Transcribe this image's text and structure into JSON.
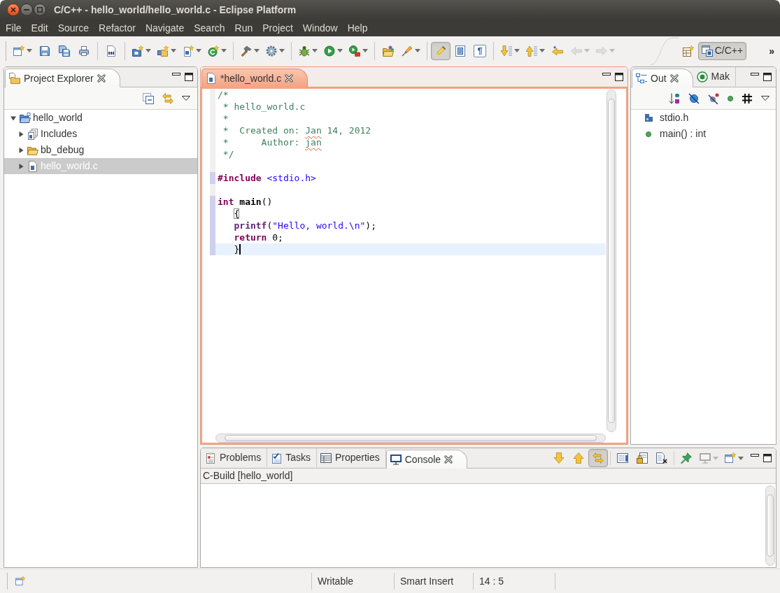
{
  "window": {
    "title": "C/C++ - hello_world/hello_world.c - Eclipse Platform"
  },
  "menu": [
    "File",
    "Edit",
    "Source",
    "Refactor",
    "Navigate",
    "Search",
    "Run",
    "Project",
    "Window",
    "Help"
  ],
  "toolbar": {
    "groups": [
      [
        {
          "dropdown": true,
          "pressed": false,
          "disabled": false
        },
        {
          "dropdown": false,
          "pressed": false,
          "disabled": false
        },
        {
          "dropdown": false,
          "pressed": false,
          "disabled": false
        },
        {
          "dropdown": false,
          "pressed": false,
          "disabled": false
        }
      ],
      [
        {
          "dropdown": false,
          "pressed": false,
          "disabled": false
        }
      ],
      [
        {
          "dropdown": true,
          "pressed": false,
          "disabled": false
        },
        {
          "dropdown": true,
          "pressed": false,
          "disabled": false
        },
        {
          "dropdown": true,
          "pressed": false,
          "disabled": false
        },
        {
          "dropdown": true,
          "pressed": false,
          "disabled": false
        }
      ],
      [
        {
          "dropdown": true,
          "pressed": false,
          "disabled": false
        },
        {
          "dropdown": true,
          "pressed": false,
          "disabled": false
        }
      ],
      [
        {
          "dropdown": true,
          "pressed": false,
          "disabled": false
        },
        {
          "dropdown": true,
          "pressed": false,
          "disabled": false
        },
        {
          "dropdown": true,
          "pressed": false,
          "disabled": false
        }
      ],
      [
        {
          "dropdown": false,
          "pressed": false,
          "disabled": false
        },
        {
          "dropdown": true,
          "pressed": false,
          "disabled": false
        }
      ],
      [
        {
          "dropdown": false,
          "pressed": true,
          "disabled": false
        },
        {
          "dropdown": false,
          "pressed": false,
          "disabled": false
        },
        {
          "glyph": "¶",
          "dropdown": false,
          "pressed": false,
          "disabled": false
        }
      ],
      [
        {
          "dropdown": true,
          "pressed": false,
          "disabled": false
        },
        {
          "dropdown": true,
          "pressed": false,
          "disabled": false
        },
        {
          "dropdown": false,
          "pressed": false,
          "disabled": false
        },
        {
          "dropdown": true,
          "pressed": false,
          "disabled": true
        },
        {
          "dropdown": true,
          "pressed": false,
          "disabled": true
        }
      ]
    ]
  },
  "perspectives": {
    "items": [
      {
        "label": "C/C++",
        "selected": true
      }
    ],
    "overflow": "»"
  },
  "project_explorer": {
    "active": false,
    "tabs": [
      {
        "label": "Project Explorer",
        "selected": true
      }
    ],
    "tree": [
      {
        "kind": "project",
        "label": "hello_world",
        "expanded": true,
        "selected": false,
        "children": [
          {
            "kind": "includes",
            "label": "Includes",
            "expanded": false,
            "selected": false
          },
          {
            "kind": "folder",
            "label": "bb_debug",
            "expanded": false,
            "selected": false
          },
          {
            "kind": "source",
            "label": "hello_world.c",
            "expanded": false,
            "selected": true
          }
        ]
      }
    ]
  },
  "editor": {
    "active": true,
    "tabs": [
      {
        "label": "*hello_world.c",
        "selected": true
      }
    ],
    "lines": [
      {
        "changed": false,
        "current": false,
        "tokens": [
          {
            "kind": "comment",
            "text": "/*"
          }
        ]
      },
      {
        "changed": false,
        "current": false,
        "tokens": [
          {
            "kind": "comment",
            "text": " * hello_world.c"
          }
        ]
      },
      {
        "changed": false,
        "current": false,
        "tokens": [
          {
            "kind": "comment",
            "text": " *"
          }
        ]
      },
      {
        "changed": false,
        "current": false,
        "tokens": [
          {
            "kind": "comment",
            "text": " *  Created on: "
          },
          {
            "kind": "misspelled",
            "text": "Jan"
          },
          {
            "kind": "comment",
            "text": " 14, 2012"
          }
        ]
      },
      {
        "changed": false,
        "current": false,
        "tokens": [
          {
            "kind": "comment",
            "text": " *      Author: "
          },
          {
            "kind": "misspelled",
            "text": "jan"
          }
        ]
      },
      {
        "changed": false,
        "current": false,
        "tokens": [
          {
            "kind": "comment",
            "text": " */"
          }
        ]
      },
      {
        "changed": false,
        "current": false
      },
      {
        "changed": true,
        "current": false,
        "tokens": [
          {
            "kind": "preprocessor",
            "text": "#include"
          },
          {
            "kind": "include",
            "text": " <stdio.h>"
          }
        ]
      },
      {
        "changed": false,
        "current": false
      },
      {
        "changed": true,
        "current": false,
        "tokens": [
          {
            "kind": "keyword",
            "text": "int"
          },
          {
            "kind": "bold",
            "text": " main"
          },
          {
            "kind": "plain",
            "text": "()"
          }
        ]
      },
      {
        "changed": true,
        "current": false,
        "tokens": [
          {
            "kind": "bracket-match",
            "text": "   {"
          }
        ]
      },
      {
        "changed": true,
        "current": false,
        "tokens": [
          {
            "kind": "function",
            "text": "   printf"
          },
          {
            "kind": "plain",
            "text": "("
          },
          {
            "kind": "string",
            "text": "\"Hello, world.\\n\""
          },
          {
            "kind": "plain",
            "text": ");"
          }
        ]
      },
      {
        "changed": true,
        "current": false,
        "tokens": [
          {
            "kind": "keyword",
            "text": "   return"
          },
          {
            "kind": "plain",
            "text": " 0;"
          }
        ]
      },
      {
        "changed": true,
        "current": true,
        "tokens": [
          {
            "kind": "plain",
            "text": "   }"
          }
        ]
      }
    ]
  },
  "outline": {
    "active": false,
    "tabs": [
      {
        "label": "Out",
        "selected": true
      },
      {
        "label": "Mak",
        "selected": false
      }
    ],
    "items": [
      {
        "kind": "include",
        "label": "stdio.h"
      },
      {
        "kind": "function",
        "label": "main() : int"
      }
    ]
  },
  "console": {
    "active": false,
    "tabs": [
      {
        "label": "Problems",
        "selected": false
      },
      {
        "label": "Tasks",
        "selected": false
      },
      {
        "label": "Properties",
        "selected": false
      },
      {
        "label": "Console",
        "selected": true
      }
    ],
    "toolbar": {
      "groups": [
        [
          {
            "dropdown": false,
            "pressed": false,
            "disabled": false
          },
          {
            "dropdown": false,
            "pressed": false,
            "disabled": false
          },
          {
            "dropdown": false,
            "pressed": true,
            "disabled": false
          }
        ],
        [
          {
            "dropdown": false,
            "pressed": false,
            "disabled": false
          },
          {
            "dropdown": false,
            "pressed": false,
            "disabled": false
          },
          {
            "dropdown": false,
            "pressed": false,
            "disabled": false
          }
        ],
        [
          {
            "dropdown": false,
            "pressed": false,
            "disabled": false
          },
          {
            "dropdown": true,
            "pressed": false,
            "disabled": true
          },
          {
            "dropdown": true,
            "pressed": false,
            "disabled": false
          }
        ]
      ]
    },
    "title": "C-Build [hello_world]"
  },
  "status_bar": {
    "fields": [
      "Writable",
      "Smart Insert",
      "14 : 5"
    ]
  }
}
